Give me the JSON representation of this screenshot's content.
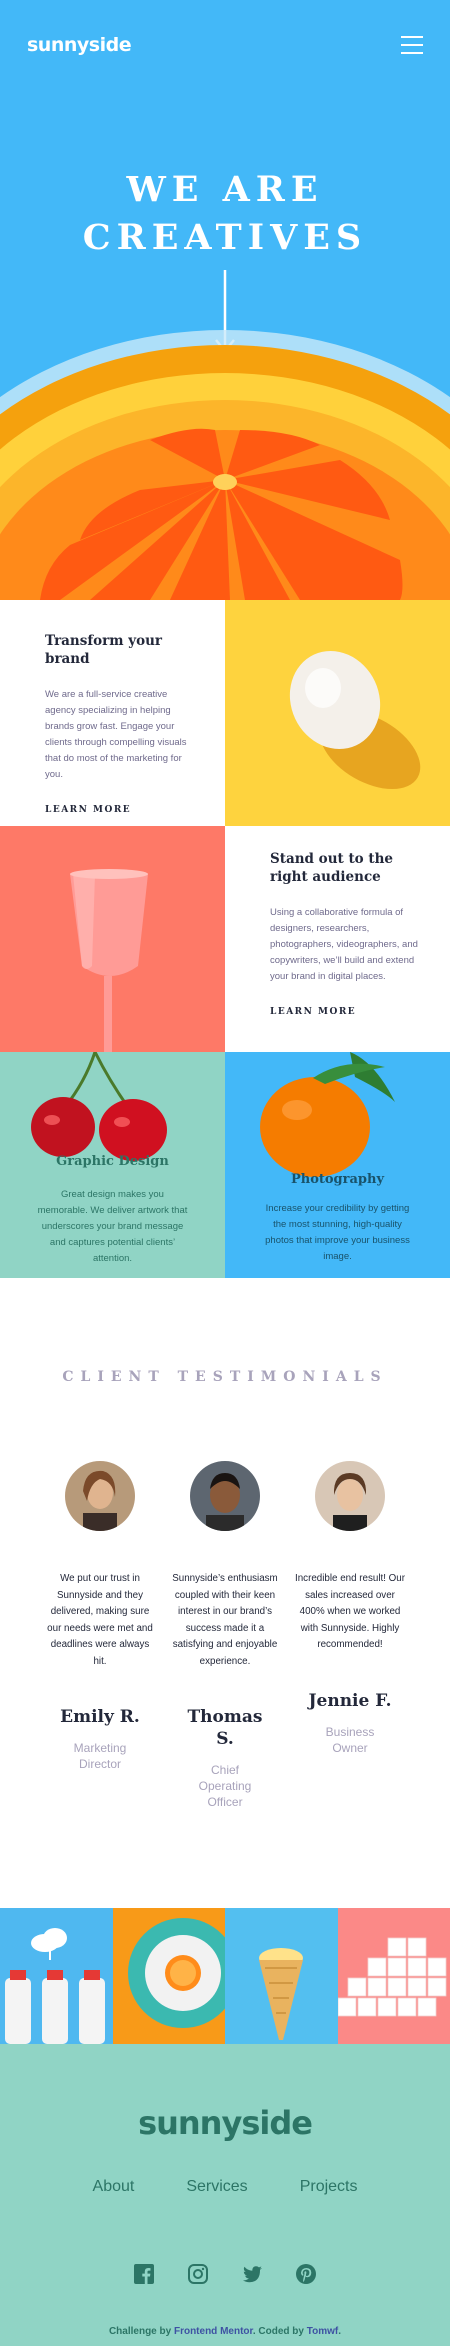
{
  "header": {
    "brand": "sunnyside",
    "menu_icon": "hamburger-icon"
  },
  "hero": {
    "title_line1": "WE ARE",
    "title_line2": "CREATIVES",
    "arrow_icon": "arrow-down-icon"
  },
  "features": [
    {
      "title": "Transform your brand",
      "body": "We are a full-service creative agency specializing in helping brands grow fast. Engage your clients through compelling visuals that do most of the marketing for you.",
      "cta": "LEARN MORE",
      "underline_color": "#fbe98a"
    },
    {
      "title": "Stand out to the right audience",
      "body": "Using a collaborative formula of designers, researchers, photographers, videographers, and copywriters, we’ll build and extend your brand in digital places.",
      "cta": "LEARN MORE",
      "underline_color": "#fcd2cc"
    }
  ],
  "services": [
    {
      "title": "Graphic Design",
      "body": "Great design makes you memorable. We deliver artwork that underscores your brand message and captures potential clients’ attention.",
      "text_color": "#2c7566"
    },
    {
      "title": "Photography",
      "body": "Increase your credibility by getting the most stunning, high-quality photos that improve your business image.",
      "text_color": "#19536b"
    }
  ],
  "testimonials": {
    "heading": "CLIENT TESTIMONIALS",
    "items": [
      {
        "quote": "We put our trust in Sunnyside and they delivered, making sure our needs were met and deadlines were always hit.",
        "name": "Emily R.",
        "role": "Marketing Director"
      },
      {
        "quote": "Sunnyside’s enthusiasm coupled with their keen interest in our brand’s success made it a satisfying and enjoyable experience.",
        "name": "Thomas S.",
        "role": "Chief Operating Officer"
      },
      {
        "quote": "Incredible end result! Our sales increased over 400% when we worked with Sunnyside. Highly recommended!",
        "name": "Jennie F.",
        "role": "Business Owner"
      }
    ]
  },
  "footer": {
    "brand": "sunnyside",
    "nav": [
      "About",
      "Services",
      "Projects"
    ],
    "social_icons": [
      "facebook-icon",
      "instagram-icon",
      "twitter-icon",
      "pinterest-icon"
    ],
    "attribution_prefix": "Challenge by ",
    "attribution_link1": "Frontend Mentor",
    "attribution_mid": ". Coded by ",
    "attribution_link2": "Tomwf",
    "attribution_suffix": "."
  },
  "colors": {
    "hero_bg": "#43b8f8",
    "yellow": "#fed33e",
    "coral": "#fe7967",
    "mint": "#90d4c5",
    "footer_text": "#2c7566"
  }
}
